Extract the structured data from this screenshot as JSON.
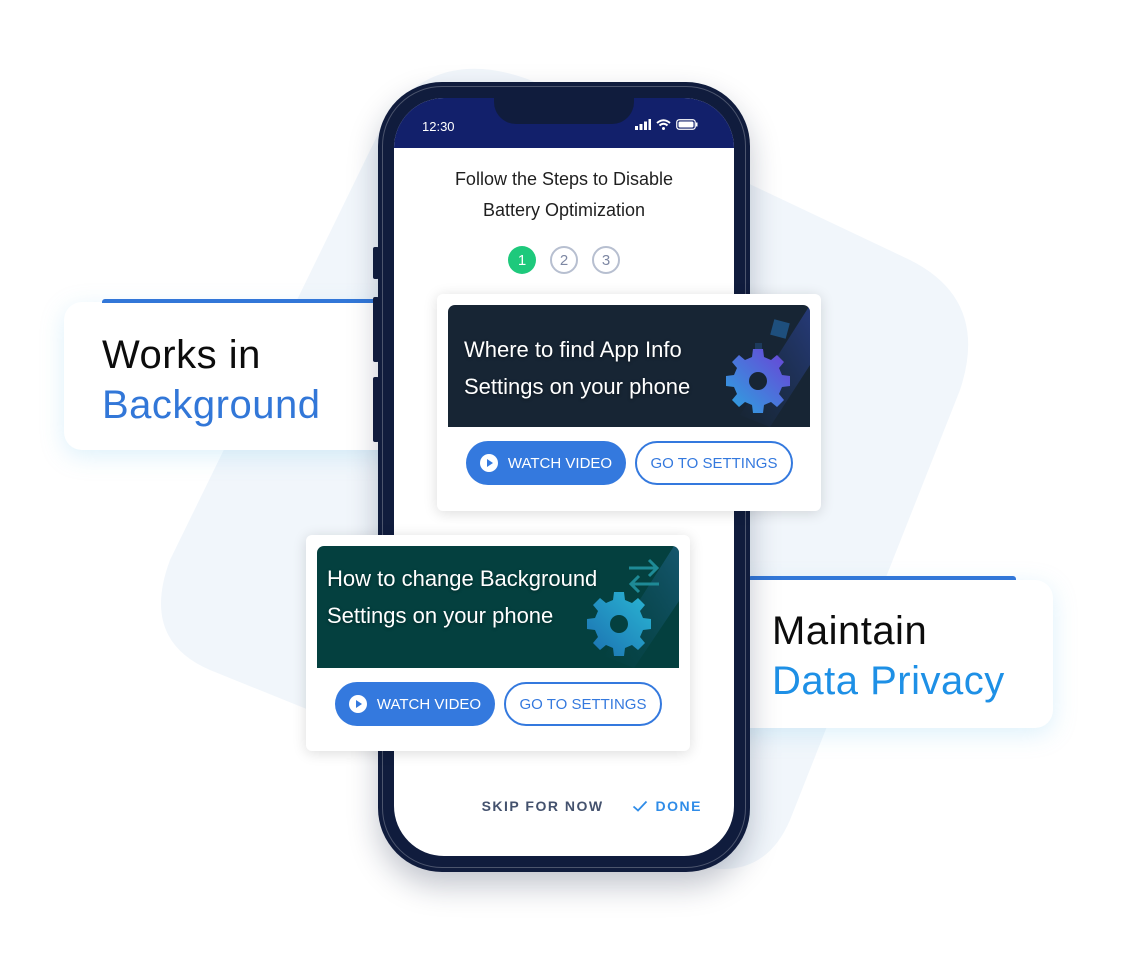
{
  "colors": {
    "phone_frame": "#101c3d",
    "status_bar": "#12206b",
    "accent_blue": "#3479de",
    "step_active": "#1ec97c",
    "done_blue": "#2f8ce8",
    "background_shape": "#f1f6fb"
  },
  "phone": {
    "status_bar": {
      "time": "12:30",
      "icons": [
        "signal-icon",
        "wifi-icon",
        "battery-icon"
      ]
    },
    "title_line1": "Follow the Steps to Disable",
    "title_line2": "Battery Optimization",
    "steps": [
      {
        "label": "1",
        "state": "active"
      },
      {
        "label": "2",
        "state": "inactive"
      },
      {
        "label": "3",
        "state": "inactive"
      }
    ],
    "footer": {
      "skip_label": "SKIP FOR NOW",
      "done_label": "DONE"
    }
  },
  "cards": [
    {
      "title_line1": "Where to find App Info",
      "title_line2": "Settings on your phone",
      "banner_color": "#172534",
      "watch_label": "WATCH VIDEO",
      "settings_label": "GO TO SETTINGS"
    },
    {
      "title_line1": "How to change Background",
      "title_line2": "Settings on your phone",
      "banner_color": "#04403f",
      "watch_label": "WATCH VIDEO",
      "settings_label": "GO TO SETTINGS"
    }
  ],
  "features": [
    {
      "line1": "Works in",
      "line2": "Background",
      "line2_color": "#3277d8"
    },
    {
      "line1": "Maintain",
      "line2": "Data Privacy",
      "line2_color": "#1e90e6"
    }
  ]
}
